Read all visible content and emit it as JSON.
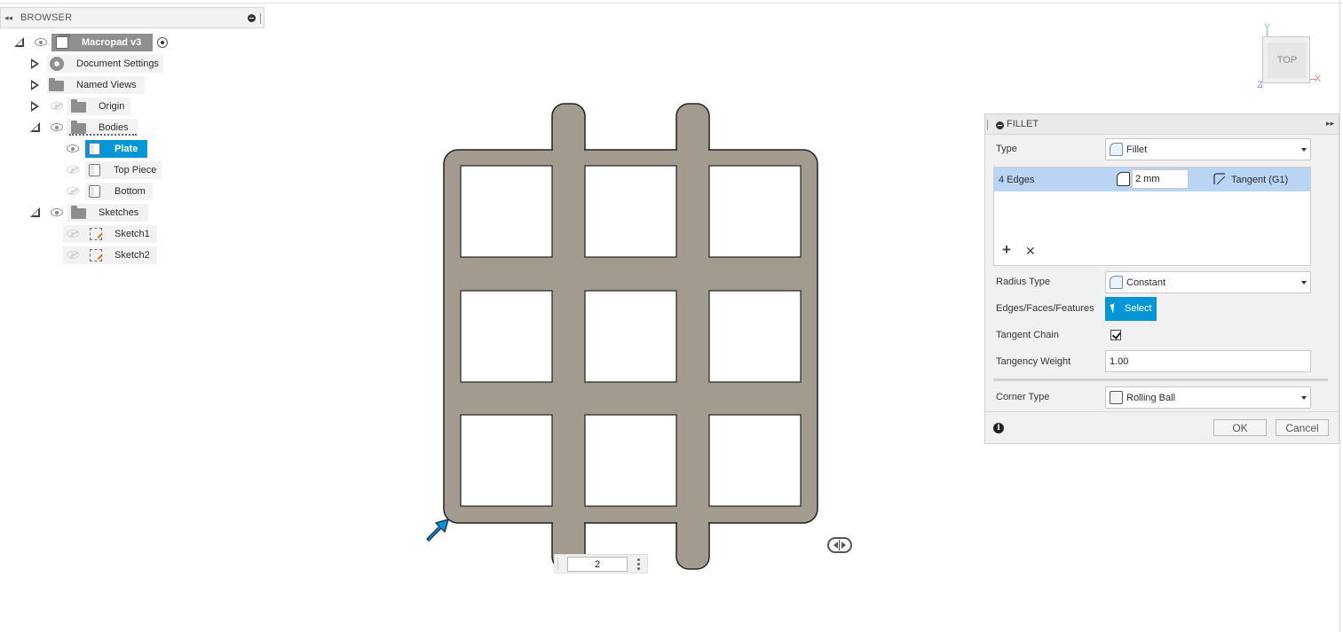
{
  "browser": {
    "collapse_glyph": "◂◂",
    "title": "BROWSER",
    "root": {
      "label": "Macropad v3",
      "icon": "component-icon"
    },
    "items": [
      {
        "label": "Document Settings",
        "icon": "gear-icon"
      },
      {
        "label": "Named Views",
        "icon": "folder-icon"
      },
      {
        "label": "Origin",
        "icon": "folder-icon"
      },
      {
        "label": "Bodies",
        "icon": "folder-icon"
      },
      {
        "label": "Plate",
        "icon": "body-icon",
        "selected": true
      },
      {
        "label": "Top Piece",
        "icon": "body-icon"
      },
      {
        "label": "Bottom",
        "icon": "body-icon"
      },
      {
        "label": "Sketches",
        "icon": "folder-icon"
      },
      {
        "label": "Sketch1",
        "icon": "sketch-icon"
      },
      {
        "label": "Sketch2",
        "icon": "sketch-icon"
      }
    ]
  },
  "viewcube": {
    "face": "TOP",
    "axis_y": "Y",
    "axis_x": "X",
    "axis_z": "Z"
  },
  "canvas": {
    "plate_color": "#a39c8e",
    "heads_up_value": "2"
  },
  "fillet": {
    "title": "FILLET",
    "type_label": "Type",
    "type_value": "Fillet",
    "edges_label": "4 Edges",
    "radius_value": "2 mm",
    "continuity": "Tangent (G1)",
    "radius_type_label": "Radius Type",
    "radius_type_value": "Constant",
    "selection_label": "Edges/Faces/Features",
    "select_button": "Select",
    "tangent_chain_label": "Tangent Chain",
    "tangent_chain_checked": true,
    "tangency_weight_label": "Tangency Weight",
    "tangency_weight_value": "1.00",
    "corner_type_label": "Corner Type",
    "corner_type_value": "Rolling Ball",
    "ok_label": "OK",
    "cancel_label": "Cancel",
    "accent_color": "#0696d7",
    "selected_row_color": "#b9d5f3"
  }
}
